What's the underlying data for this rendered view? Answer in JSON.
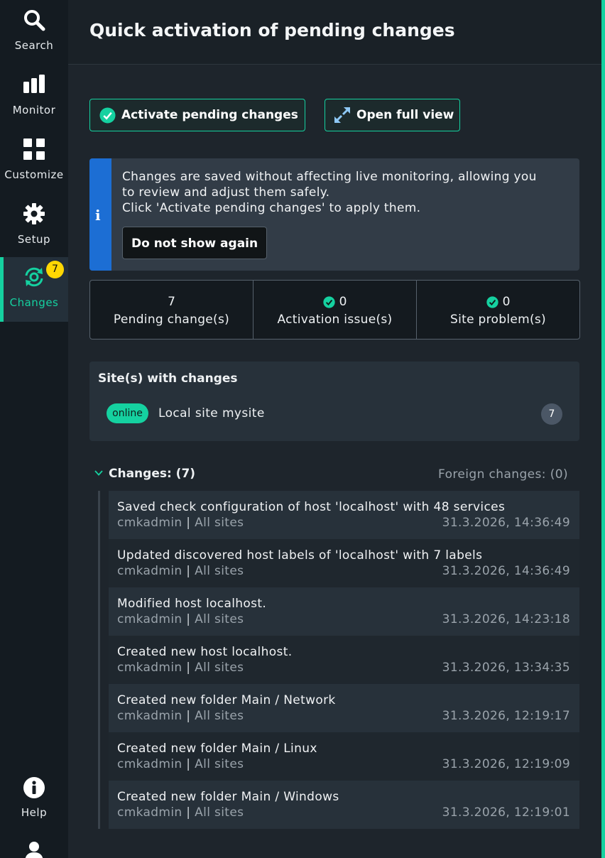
{
  "nav": {
    "items": [
      {
        "label": "Search",
        "icon": "search-icon"
      },
      {
        "label": "Monitor",
        "icon": "bar-chart-icon"
      },
      {
        "label": "Customize",
        "icon": "grid-icon"
      },
      {
        "label": "Setup",
        "icon": "gear-icon"
      },
      {
        "label": "Changes",
        "icon": "sync-changes-icon",
        "badge": "7"
      }
    ],
    "help_label": "Help"
  },
  "header": {
    "title": "Quick activation of pending changes"
  },
  "actions": {
    "activate_label": "Activate pending changes",
    "full_view_label": "Open full view"
  },
  "info": {
    "line1": "Changes are saved without affecting live monitoring, allowing you",
    "line2": "to review and adjust them safely.",
    "line3": "Click 'Activate pending changes' to apply them.",
    "dismiss_label": "Do not show again"
  },
  "stats": [
    {
      "value": "7",
      "label": "Pending change(s)"
    },
    {
      "value": "0",
      "label": "Activation issue(s)"
    },
    {
      "value": "0",
      "label": "Site problem(s)"
    }
  ],
  "sites": {
    "title": "Site(s) with changes",
    "items": [
      {
        "status": "online",
        "name": "Local site mysite",
        "count": "7"
      }
    ]
  },
  "changes": {
    "title": "Changes: (7)",
    "foreign_label": "Foreign changes: (0)",
    "items": [
      {
        "text": "Saved check configuration of host 'localhost' with 48 services",
        "user": "cmkadmin",
        "sites": "All sites",
        "time": "31.3.2026, 14:36:49"
      },
      {
        "text": "Updated discovered host labels of 'localhost' with 7 labels",
        "user": "cmkadmin",
        "sites": "All sites",
        "time": "31.3.2026, 14:36:49"
      },
      {
        "text": "Modified host localhost.",
        "user": "cmkadmin",
        "sites": "All sites",
        "time": "31.3.2026, 14:23:18"
      },
      {
        "text": "Created new host localhost.",
        "user": "cmkadmin",
        "sites": "All sites",
        "time": "31.3.2026, 13:34:35"
      },
      {
        "text": "Created new folder Main / Network",
        "user": "cmkadmin",
        "sites": "All sites",
        "time": "31.3.2026, 12:19:17"
      },
      {
        "text": "Created new folder Main / Linux",
        "user": "cmkadmin",
        "sites": "All sites",
        "time": "31.3.2026, 12:19:09"
      },
      {
        "text": "Created new folder Main / Windows",
        "user": "cmkadmin",
        "sites": "All sites",
        "time": "31.3.2026, 12:19:01"
      }
    ]
  },
  "colors": {
    "accent": "#15d1a0",
    "badge": "#ffd703",
    "info_stripe": "#1c6ed4"
  }
}
